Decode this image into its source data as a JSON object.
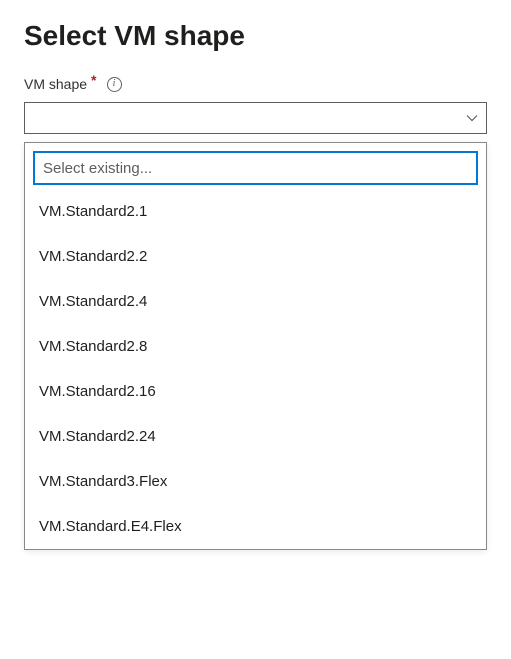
{
  "header": {
    "title": "Select VM shape"
  },
  "field": {
    "label": "VM shape",
    "required_marker": "*"
  },
  "search": {
    "placeholder": "Select existing..."
  },
  "options": [
    {
      "label": "VM.Standard2.1"
    },
    {
      "label": "VM.Standard2.2"
    },
    {
      "label": "VM.Standard2.4"
    },
    {
      "label": "VM.Standard2.8"
    },
    {
      "label": "VM.Standard2.16"
    },
    {
      "label": "VM.Standard2.24"
    },
    {
      "label": "VM.Standard3.Flex"
    },
    {
      "label": "VM.Standard.E4.Flex"
    }
  ]
}
